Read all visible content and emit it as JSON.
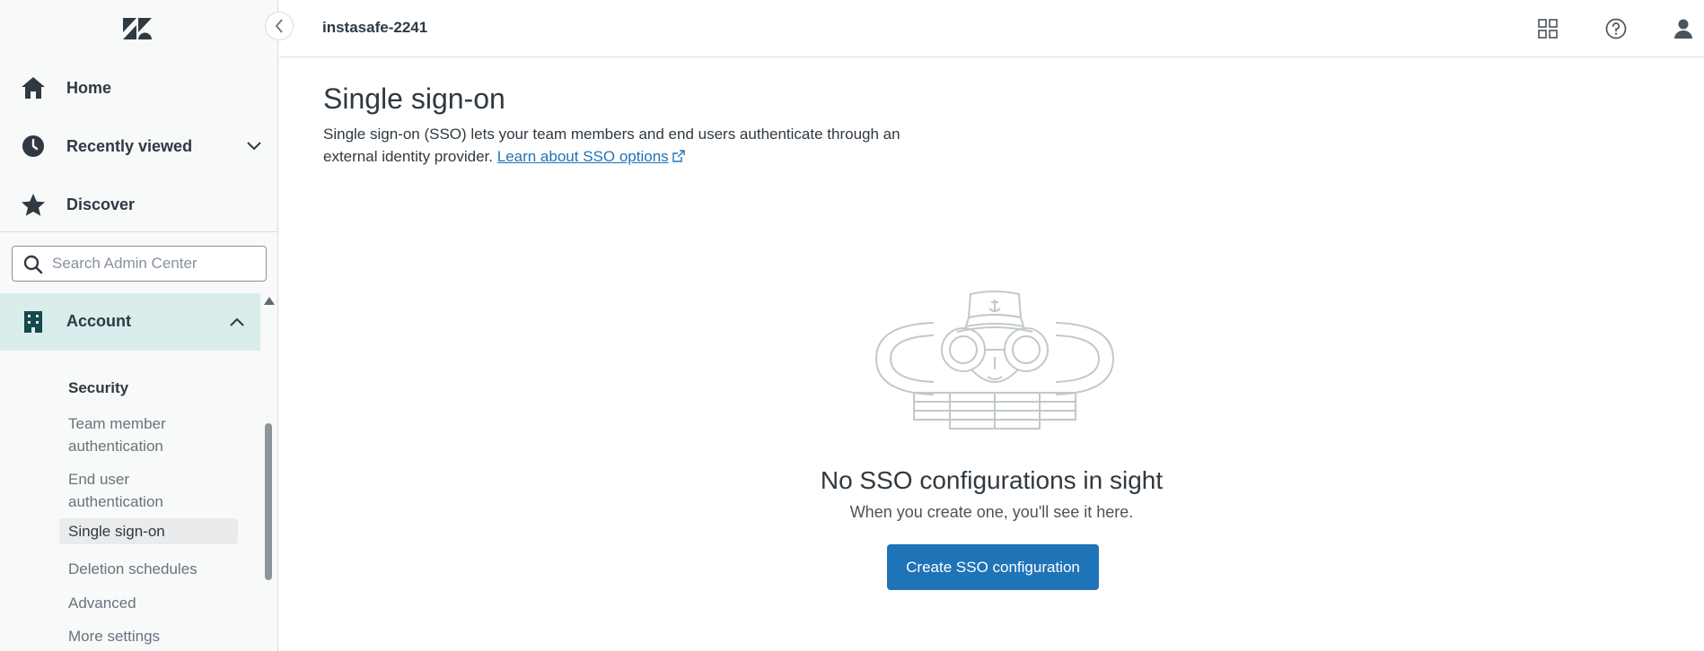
{
  "sidebar": {
    "collapse_icon": "chevron-left-icon",
    "nav": [
      {
        "label": "Home",
        "icon": "home-icon"
      },
      {
        "label": "Recently viewed",
        "icon": "clock-icon"
      },
      {
        "label": "Discover",
        "icon": "star-icon"
      }
    ],
    "search": {
      "placeholder": "Search Admin Center",
      "value": ""
    },
    "account": {
      "label": "Account",
      "icon": "building-icon",
      "expanded": true
    },
    "section": {
      "heading": "Security",
      "items": [
        {
          "label": "Team member authentication",
          "active": false
        },
        {
          "label": "End user authentication",
          "active": false
        },
        {
          "label": "Single sign-on",
          "active": true
        },
        {
          "label": "Deletion schedules",
          "active": false
        },
        {
          "label": "Advanced",
          "active": false
        },
        {
          "label": "More settings",
          "active": false
        }
      ]
    }
  },
  "topbar": {
    "workspace": "instasafe-2241",
    "icons": [
      "products-grid-icon",
      "help-icon",
      "user-icon"
    ]
  },
  "main": {
    "title": "Single sign-on",
    "description": "Single sign-on (SSO) lets your team members and end users authenticate through an external identity provider.",
    "learn_link": "Learn about SSO options",
    "empty_state": {
      "title": "No SSO configurations in sight",
      "subtitle": "When you create one, you'll see it here.",
      "button": "Create SSO configuration"
    }
  },
  "colors": {
    "accent": "#1f73b7",
    "sidebar_bg": "#f8f9f9",
    "active_group": "#d9edec",
    "active_item": "#e9ebed",
    "brand_icon": "#17494d",
    "text": "#2f3941"
  }
}
